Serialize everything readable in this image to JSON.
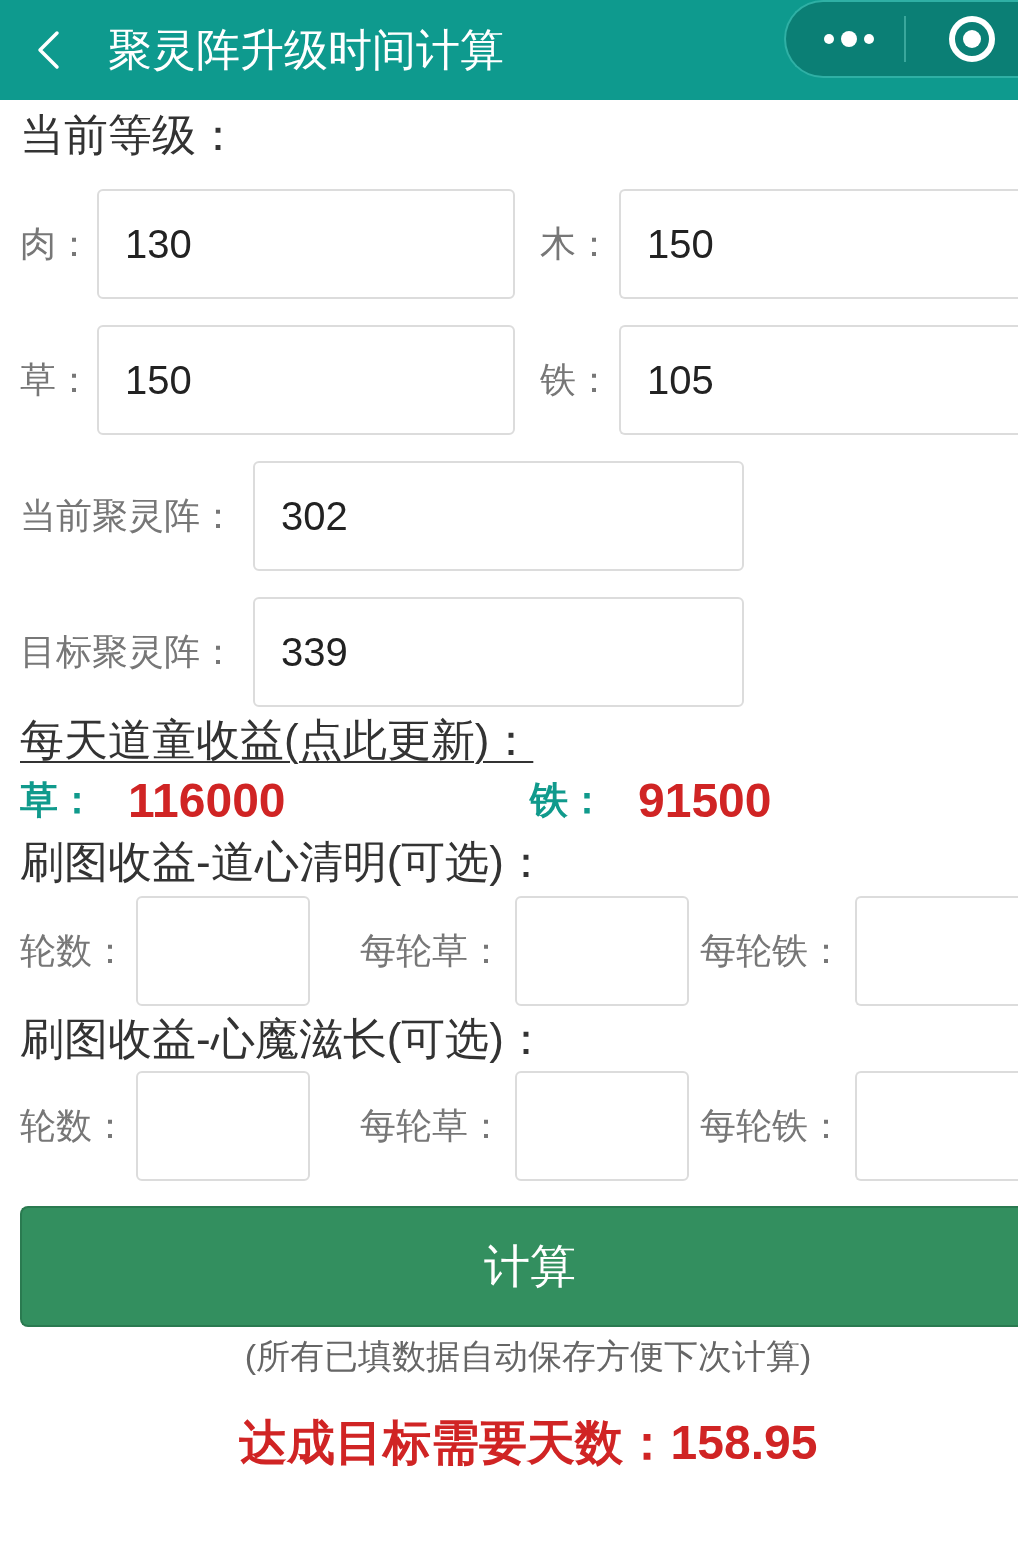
{
  "header": {
    "title": "聚灵阵升级时间计算"
  },
  "current_level": {
    "heading": "当前等级：",
    "fields": [
      {
        "label": "肉：",
        "value": "130"
      },
      {
        "label": "木：",
        "value": "150"
      },
      {
        "label": "草：",
        "value": "150"
      },
      {
        "label": "铁：",
        "value": "105"
      }
    ]
  },
  "formation": [
    {
      "label": "当前聚灵阵：",
      "value": "302"
    },
    {
      "label": "目标聚灵阵：",
      "value": "339"
    }
  ],
  "daily_income": {
    "link": "每天道童收益(点此更新)：",
    "items": [
      {
        "label": "草：",
        "value": "116000"
      },
      {
        "label": "铁：",
        "value": "91500"
      }
    ]
  },
  "farming_sections": [
    {
      "heading": "刷图收益-道心清明(可选)：",
      "fields": [
        {
          "label": "轮数："
        },
        {
          "label": "每轮草："
        },
        {
          "label": "每轮铁："
        }
      ]
    },
    {
      "heading": "刷图收益-心魔滋长(可选)：",
      "fields": [
        {
          "label": "轮数："
        },
        {
          "label": "每轮草："
        },
        {
          "label": "每轮铁："
        }
      ]
    }
  ],
  "calculate_button": "计算",
  "note": "(所有已填数据自动保存方便下次计算)",
  "result": "达成目标需要天数：158.95"
}
